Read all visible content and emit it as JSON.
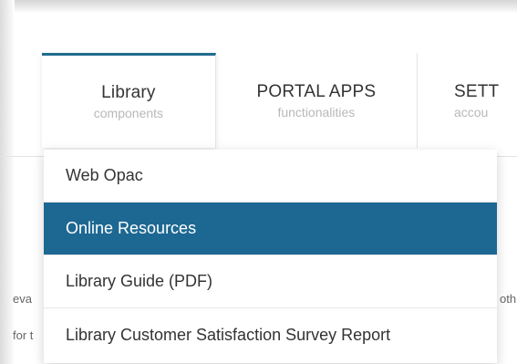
{
  "nav": {
    "tabs": [
      {
        "title": "Library",
        "subtitle": "components",
        "active": true
      },
      {
        "title": "PORTAL APPS",
        "subtitle": "functionalities",
        "active": false
      },
      {
        "title": "SETT",
        "subtitle": "accou",
        "active": false
      }
    ]
  },
  "dropdown": {
    "items": [
      {
        "label": "Web Opac",
        "selected": false
      },
      {
        "label": "Online Resources",
        "selected": true
      },
      {
        "label": "Library Guide (PDF)",
        "selected": false
      },
      {
        "label": "Library Customer Satisfaction Survey Report",
        "selected": false
      }
    ]
  },
  "background": {
    "fragment_left_1": "eva",
    "fragment_left_2": "for t",
    "fragment_right_1": "oth"
  },
  "colors": {
    "accent": "#1d6893",
    "tab_border": "#1e6b8e",
    "subtitle": "#b8b8b8"
  }
}
